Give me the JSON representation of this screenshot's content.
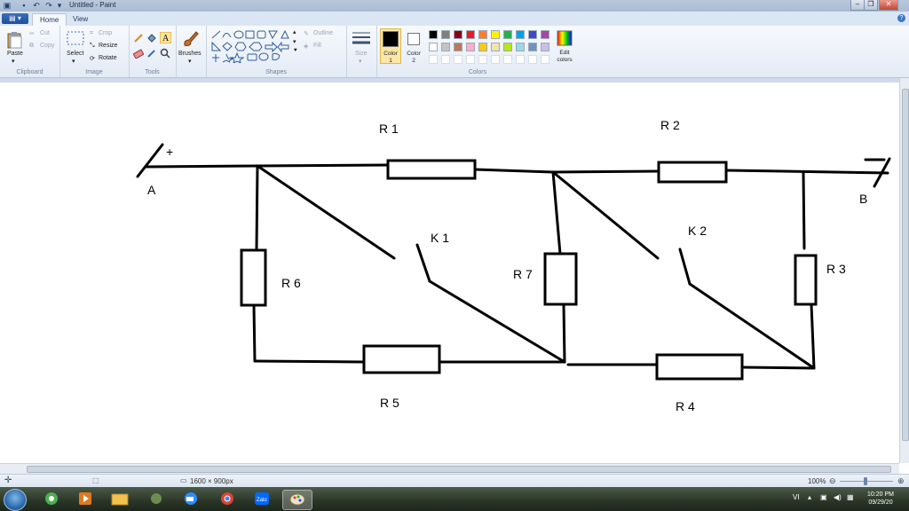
{
  "window": {
    "title": "Untitled - Paint"
  },
  "tabs": {
    "home": "Home",
    "view": "View"
  },
  "ribbon": {
    "clipboard": {
      "label": "Clipboard",
      "paste": "Paste",
      "cut": "Cut",
      "copy": "Copy"
    },
    "image": {
      "label": "Image",
      "select": "Select",
      "crop": "Crop",
      "resize": "Resize",
      "rotate": "Rotate"
    },
    "tools": {
      "label": "Tools"
    },
    "brushes": {
      "label": "Brushes"
    },
    "shapes": {
      "label": "Shapes",
      "outline": "Outline",
      "fill": "Fill"
    },
    "size": {
      "label": "Size"
    },
    "colors": {
      "label": "Colors",
      "color1": "Color 1",
      "color2": "Color 2",
      "edit": "Edit colors",
      "color1_value": "#000000",
      "color2_value": "#ffffff",
      "palette_row1": [
        "#000000",
        "#7f7f7f",
        "#880015",
        "#ed1c24",
        "#ff7f27",
        "#fff200",
        "#22b14c",
        "#00a2e8",
        "#3f48cc",
        "#a349a4"
      ],
      "palette_row2": [
        "#ffffff",
        "#c3c3c3",
        "#b97a57",
        "#ffaec9",
        "#ffc90e",
        "#efe4b0",
        "#b5e61d",
        "#99d9ea",
        "#7092be",
        "#c8bfe7"
      ]
    }
  },
  "drawing": {
    "terminal_a": "A",
    "terminal_b": "B",
    "plus": "+",
    "r1": "R 1",
    "r2": "R 2",
    "r3": "R 3",
    "r4": "R 4",
    "r5": "R 5",
    "r6": "R 6",
    "r7": "R 7",
    "k1": "K 1",
    "k2": "K 2"
  },
  "status": {
    "dimensions": "1600 × 900px",
    "zoom": "100%"
  },
  "taskbar": {
    "language": "VI",
    "time": "10:20 PM",
    "date": "09/29/20"
  }
}
